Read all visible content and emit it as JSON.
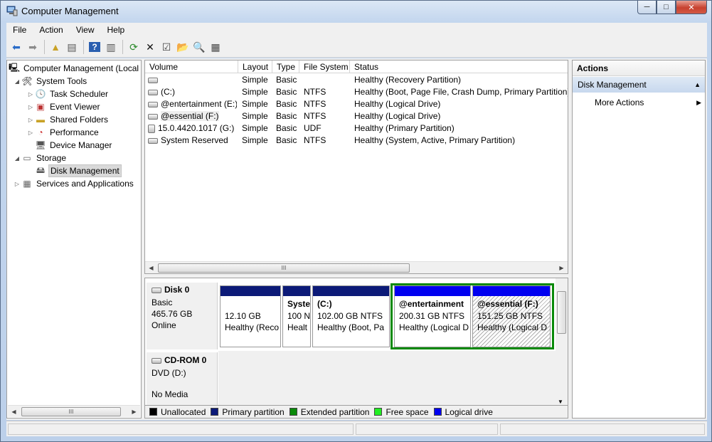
{
  "window": {
    "title": "Computer Management",
    "buttons": [
      "─",
      "□",
      "✕"
    ]
  },
  "menu": [
    {
      "label": "File"
    },
    {
      "label": "Action"
    },
    {
      "label": "View"
    },
    {
      "label": "Help"
    }
  ],
  "tree": {
    "items": [
      {
        "label": "Computer Management (Local",
        "icon": "computer-icon"
      },
      {
        "label": "System Tools",
        "icon": "tools-icon"
      },
      {
        "label": "Task Scheduler",
        "icon": "clock-icon"
      },
      {
        "label": "Event Viewer",
        "icon": "event-viewer-icon"
      },
      {
        "label": "Shared Folders",
        "icon": "shared-folder-icon"
      },
      {
        "label": "Performance",
        "icon": "performance-icon"
      },
      {
        "label": "Device Manager",
        "icon": "device-manager-icon"
      },
      {
        "label": "Storage",
        "icon": "storage-icon"
      },
      {
        "label": "Disk Management",
        "icon": "disk-management-icon"
      },
      {
        "label": "Services and Applications",
        "icon": "services-icon"
      }
    ]
  },
  "volumes": {
    "columns": [
      "Volume",
      "Layout",
      "Type",
      "File System",
      "Status"
    ],
    "rows": [
      {
        "volume": "",
        "layout": "Simple",
        "type": "Basic",
        "fs": "",
        "status": "Healthy (Recovery Partition)"
      },
      {
        "volume": "(C:)",
        "layout": "Simple",
        "type": "Basic",
        "fs": "NTFS",
        "status": "Healthy (Boot, Page File, Crash Dump, Primary Partition)"
      },
      {
        "volume": "@entertainment (E:)",
        "layout": "Simple",
        "type": "Basic",
        "fs": "NTFS",
        "status": "Healthy (Logical Drive)"
      },
      {
        "volume": "@essential (F:)",
        "layout": "Simple",
        "type": "Basic",
        "fs": "NTFS",
        "status": "Healthy (Logical Drive)"
      },
      {
        "volume": "15.0.4420.1017 (G:)",
        "layout": "Simple",
        "type": "Basic",
        "fs": "UDF",
        "status": "Healthy (Primary Partition)"
      },
      {
        "volume": "System Reserved",
        "layout": "Simple",
        "type": "Basic",
        "fs": "NTFS",
        "status": "Healthy (System, Active, Primary Partition)"
      }
    ]
  },
  "disks": {
    "disk0": {
      "name": "Disk 0",
      "type": "Basic",
      "size": "465.76 GB",
      "state": "Online",
      "partitions": [
        {
          "title": "",
          "size": "12.10 GB",
          "status": "Healthy (Reco"
        },
        {
          "title": "Syste",
          "size": "100 N",
          "status": "Healt"
        },
        {
          "title": "(C:)",
          "size": "102.00 GB NTFS",
          "status": "Healthy (Boot, Pa"
        },
        {
          "title": "@entertainment",
          "size": "200.31 GB NTFS",
          "status": "Healthy (Logical D"
        },
        {
          "title": "@essential  (F:)",
          "size": "151.25 GB NTFS",
          "status": "Healthy (Logical D"
        }
      ]
    },
    "cdrom0": {
      "name": "CD-ROM 0",
      "type": "DVD (D:)",
      "media": "No Media"
    }
  },
  "legend": [
    {
      "label": "Unallocated",
      "color": "#000000"
    },
    {
      "label": "Primary partition",
      "color": "#0c1a78"
    },
    {
      "label": "Extended partition",
      "color": "#0a8a0a"
    },
    {
      "label": "Free space",
      "color": "#22ee22"
    },
    {
      "label": "Logical drive",
      "color": "#0000f0"
    }
  ],
  "actions": {
    "header": "Actions",
    "section": "Disk Management",
    "items": [
      {
        "label": "More Actions"
      }
    ]
  },
  "scroll": {
    "grip": "III"
  }
}
